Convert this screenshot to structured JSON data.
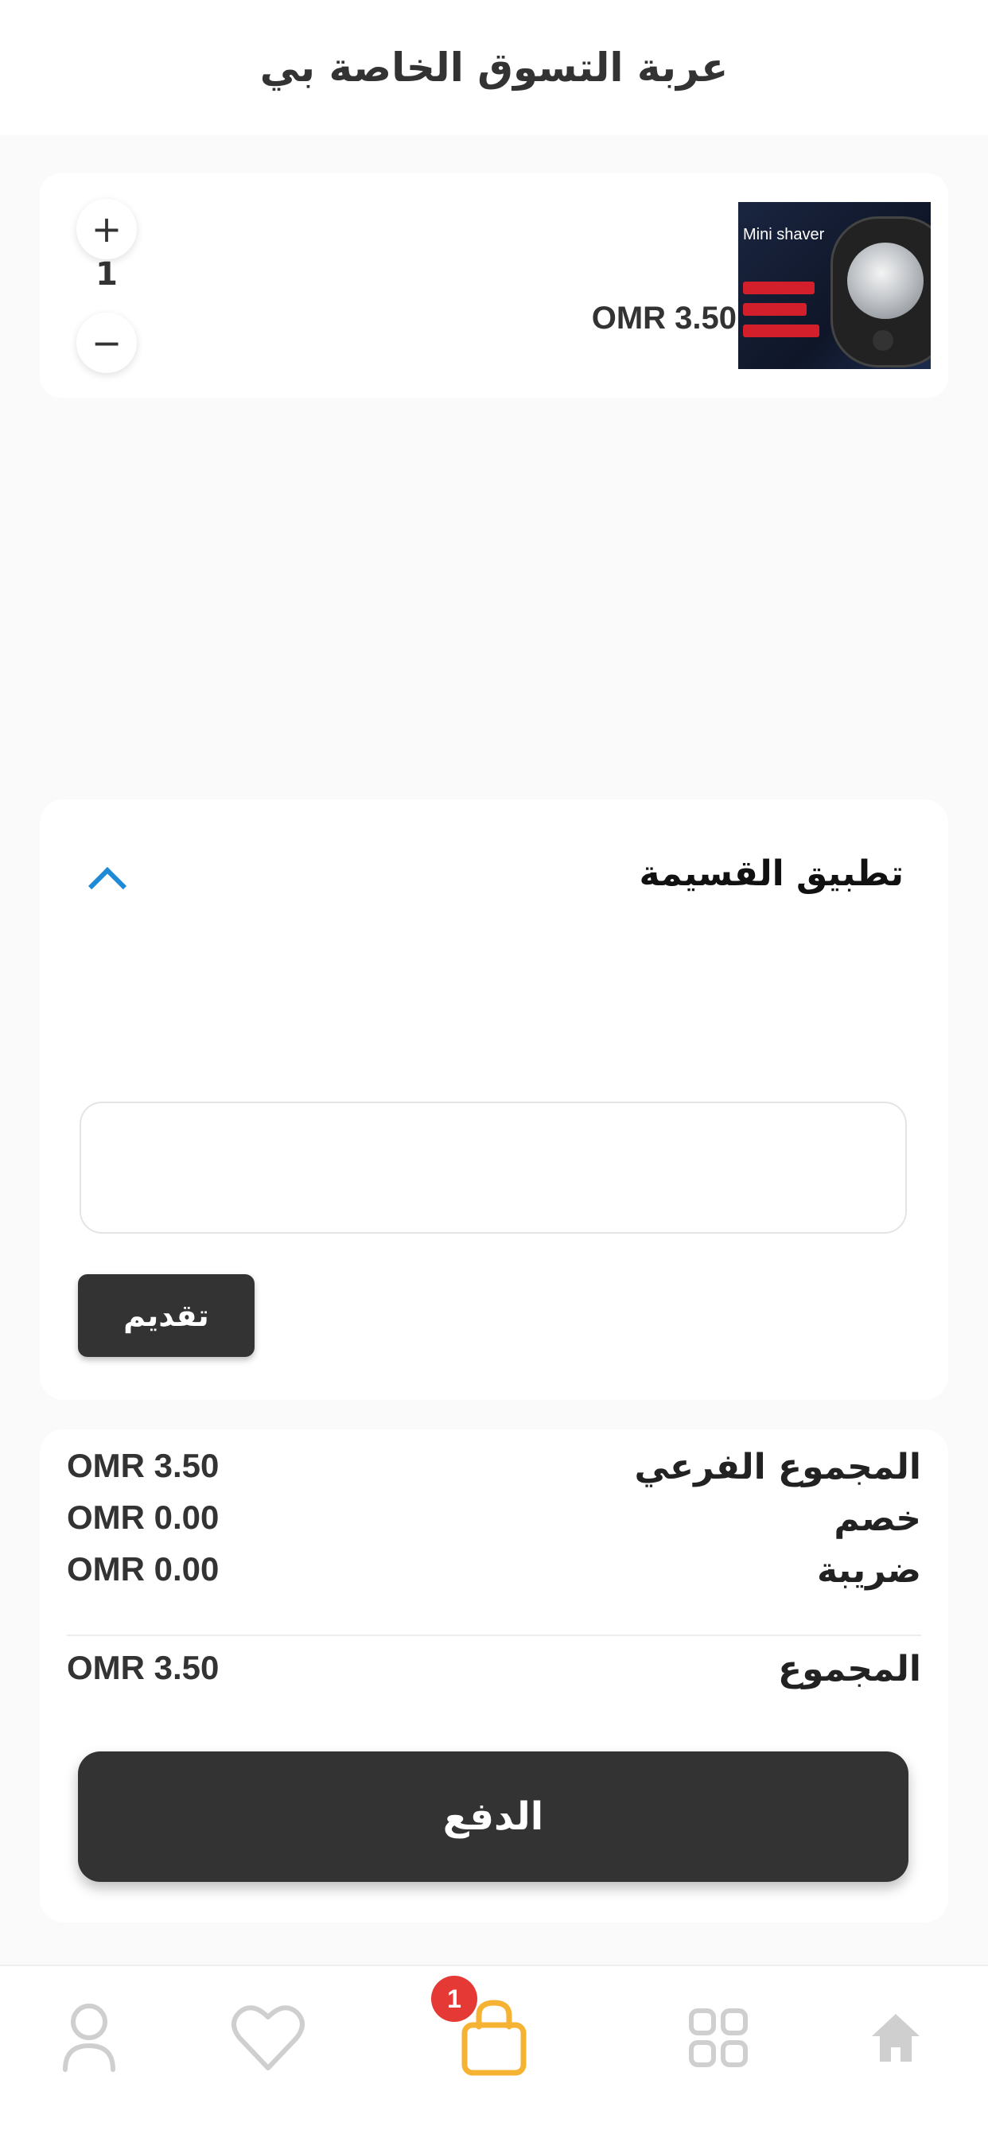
{
  "header": {
    "title": "عربة التسوق الخاصة بي"
  },
  "cart_items": [
    {
      "image_text": "Mini shaver",
      "price": "OMR 3.50",
      "quantity": "1",
      "increase_label": "+",
      "decrease_label": "−"
    }
  ],
  "coupon": {
    "title": "تطبيق القسيمة",
    "input_value": "",
    "input_placeholder": "",
    "apply_label": "تقديم"
  },
  "summary": {
    "subtotal_label": "المجموع الفرعي",
    "subtotal_value": "OMR 3.50",
    "discount_label": "خصم",
    "discount_value": "OMR 0.00",
    "tax_label": "ضريبة",
    "tax_value": "OMR 0.00",
    "total_label": "المجموع",
    "total_value": "OMR 3.50",
    "checkout_label": "الدفع"
  },
  "bottom_nav": {
    "cart_badge": "1",
    "icons": [
      "person-icon",
      "heart-icon",
      "shopping-bag-icon",
      "grid-icon",
      "home-icon"
    ],
    "active_color": "#f6b233",
    "inactive_color": "#cfcfcf"
  },
  "colors": {
    "accent_blue": "#1f8ad6",
    "dark_button": "#333333",
    "badge_red": "#e53935"
  }
}
